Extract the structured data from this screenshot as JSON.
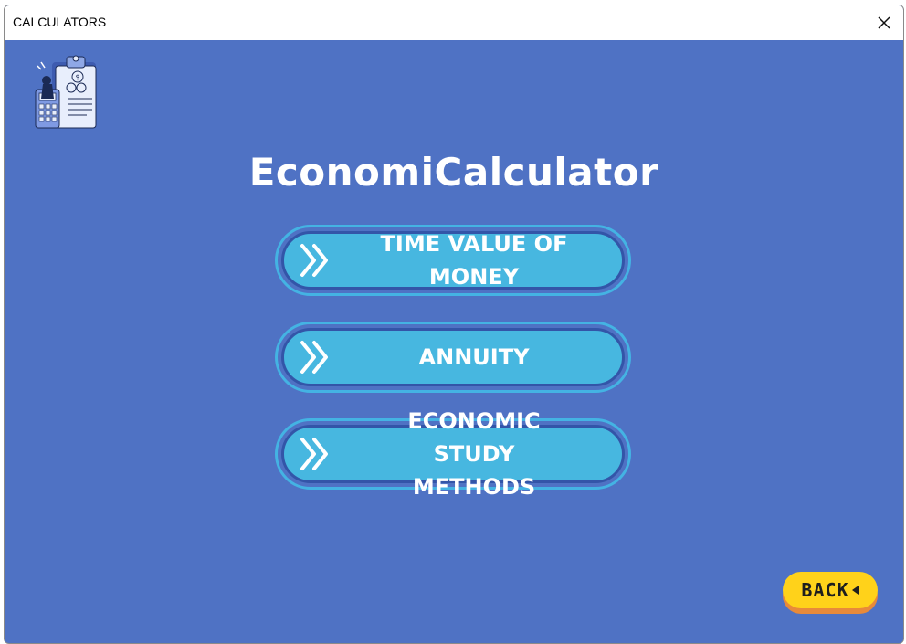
{
  "window": {
    "title": "CALCULATORS"
  },
  "app": {
    "title": "EconomiCalculator",
    "logo_icon": "calculator-clipboard-illustration-icon"
  },
  "menu": {
    "items": [
      {
        "label": "TIME VALUE OF MONEY",
        "icon": "double-chevron-right-icon"
      },
      {
        "label": "ANNUITY",
        "icon": "double-chevron-right-icon"
      },
      {
        "label": "ECONOMIC STUDY METHODS",
        "icon": "double-chevron-right-icon"
      }
    ]
  },
  "back_button": {
    "label": "BACK",
    "icon": "triangle-left-icon"
  },
  "colors": {
    "background": "#4f72c4",
    "menu_button": "#47b7e0",
    "back_button": "#ffd21a",
    "back_button_shadow": "#e88a3a"
  }
}
